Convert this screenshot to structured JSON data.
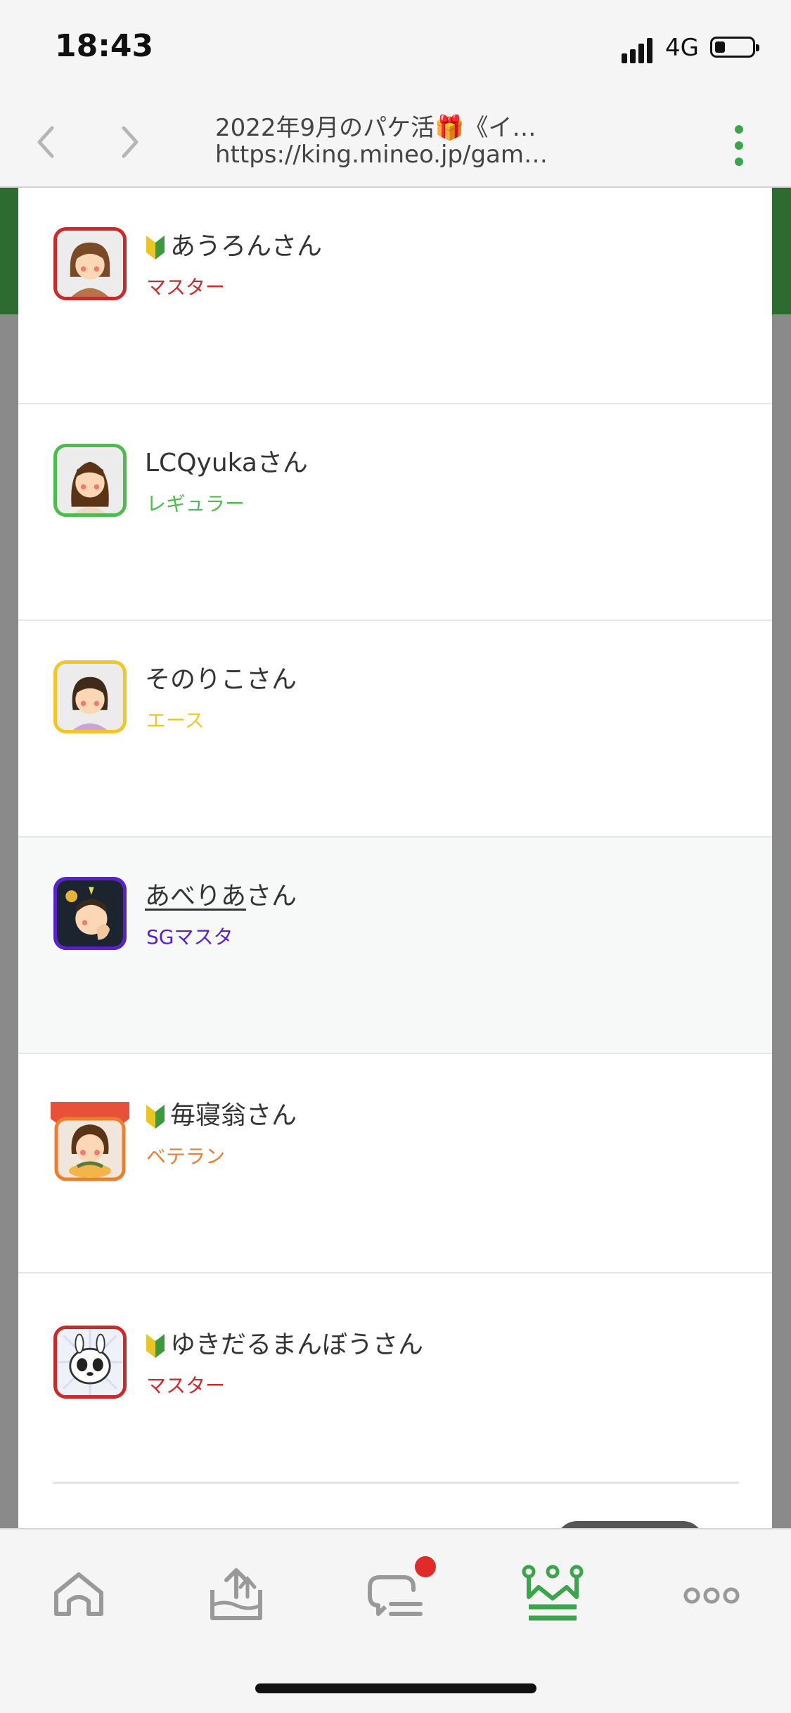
{
  "status_bar": {
    "time": "18:43",
    "network": "4G"
  },
  "browser": {
    "page_title": "2022年9月のパケ活🎁《イ…",
    "url": "https://king.mineo.jp/gam…"
  },
  "users": [
    {
      "name": "あうろんさん",
      "rank": "マスター",
      "beginner": true
    },
    {
      "name": "LCQyukaさん",
      "rank": "レギュラー",
      "beginner": false
    },
    {
      "name": "そのりこさん",
      "rank": "エース",
      "beginner": false
    },
    {
      "name_link": "あべりあ",
      "name_suffix": "さん",
      "rank": "SGマスタ",
      "beginner": false
    },
    {
      "name": "毎寝翁さん",
      "rank": "ベテラン",
      "beginner": true
    },
    {
      "name": "ゆきだるまんぼうさん",
      "rank": "マスター",
      "beginner": true
    }
  ],
  "colors": {
    "accent_green": "#3aa54a",
    "header_green": "#2e6b31",
    "rank_master": "#cc2a2a",
    "rank_regular": "#4cbc4c",
    "rank_ace": "#f2c62a",
    "rank_sg_master": "#5a1fd1",
    "rank_veteran": "#ee7d2c",
    "notification": "#e02b2b"
  },
  "tabs": [
    {
      "icon": "home-icon"
    },
    {
      "icon": "upload-tray-icon"
    },
    {
      "icon": "chat-icon",
      "badge": true
    },
    {
      "icon": "crown-icon",
      "active": true
    },
    {
      "icon": "more-icon"
    }
  ]
}
